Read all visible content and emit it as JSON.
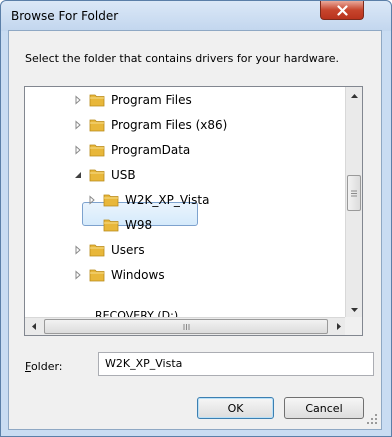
{
  "window": {
    "title": "Browse For Folder"
  },
  "instruction": "Select the folder that contains drivers for your hardware.",
  "tree": {
    "items": [
      {
        "label": "Program Files",
        "expander": "collapsed"
      },
      {
        "label": "Program Files (x86)",
        "expander": "collapsed"
      },
      {
        "label": "ProgramData",
        "expander": "collapsed"
      },
      {
        "label": "USB",
        "expander": "expanded"
      },
      {
        "label": "W2K_XP_Vista",
        "expander": "collapsed",
        "selected": true
      },
      {
        "label": "W98",
        "expander": "none"
      },
      {
        "label": "Users",
        "expander": "collapsed"
      },
      {
        "label": "Windows",
        "expander": "collapsed"
      },
      {
        "label": "RECOVERY (D:)",
        "expander": "none"
      }
    ]
  },
  "folder_field": {
    "label_accel": "F",
    "label_rest": "older:",
    "value": "W2K_XP_Vista"
  },
  "buttons": {
    "ok": "OK",
    "cancel": "Cancel"
  },
  "colors": {
    "folder": "#e8b73a",
    "selection": "#d5eafb",
    "close": "#c7452d"
  },
  "icons": [
    "close-icon",
    "folder-icon",
    "expand-arrow-icon",
    "collapse-arrow-icon",
    "scroll-up-icon",
    "scroll-down-icon",
    "scroll-left-icon",
    "scroll-right-icon",
    "resize-grip-icon"
  ]
}
